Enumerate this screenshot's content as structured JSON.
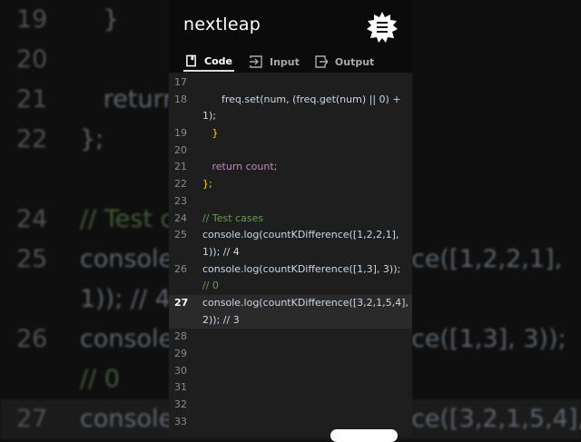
{
  "app": {
    "logo": "nextleap",
    "menu_icon": "menu-badge-icon"
  },
  "tabs": [
    {
      "label": "Code",
      "icon": "notebook-icon",
      "active": true
    },
    {
      "label": "Input",
      "icon": "input-arrow-icon"
    },
    {
      "label": "Output",
      "icon": "output-arrow-icon"
    }
  ],
  "code_lines": [
    {
      "n": "17",
      "text": ""
    },
    {
      "n": "18",
      "text": "      freq.set(num, (freq.get(num) || 0) +"
    },
    {
      "n": "",
      "text": "1);"
    },
    {
      "n": "19",
      "text": "   }"
    },
    {
      "n": "20",
      "text": ""
    },
    {
      "n": "21",
      "text": "   return count;"
    },
    {
      "n": "22",
      "text": "};"
    },
    {
      "n": "23",
      "text": ""
    },
    {
      "n": "24",
      "text": "// Test cases"
    },
    {
      "n": "25",
      "text": "console.log(countKDifference([1,2,2,1],"
    },
    {
      "n": "",
      "text": "1)); // 4"
    },
    {
      "n": "26",
      "text": "console.log(countKDifference([1,3], 3));"
    },
    {
      "n": "",
      "text": "// 0"
    },
    {
      "n": "27",
      "text": "console.log(countKDifference([3,2,1,5,4],"
    },
    {
      "n": "",
      "text": "2)); // 3"
    },
    {
      "n": "28",
      "text": ""
    },
    {
      "n": "29",
      "text": ""
    },
    {
      "n": "30",
      "text": ""
    },
    {
      "n": "31",
      "text": ""
    },
    {
      "n": "32",
      "text": ""
    },
    {
      "n": "33",
      "text": ""
    }
  ],
  "background_lines": [
    {
      "n": "19",
      "text": "   }"
    },
    {
      "n": "20",
      "text": ""
    },
    {
      "n": "21",
      "text": "   return count;"
    },
    {
      "n": "22",
      "text": "};"
    },
    {
      "n": "",
      "text": ""
    },
    {
      "n": "24",
      "text": "// Test cases"
    },
    {
      "n": "25",
      "text": "console.log(countKDifference([1,2,2,1],"
    },
    {
      "n": "",
      "text": "1)); // 4"
    },
    {
      "n": "26",
      "text": "console.log(countKDifference([1,3], 3));"
    },
    {
      "n": "",
      "text": "// 0"
    },
    {
      "n": "27",
      "text": "console.log(countKDifference([3,2,1,5,4],"
    }
  ]
}
